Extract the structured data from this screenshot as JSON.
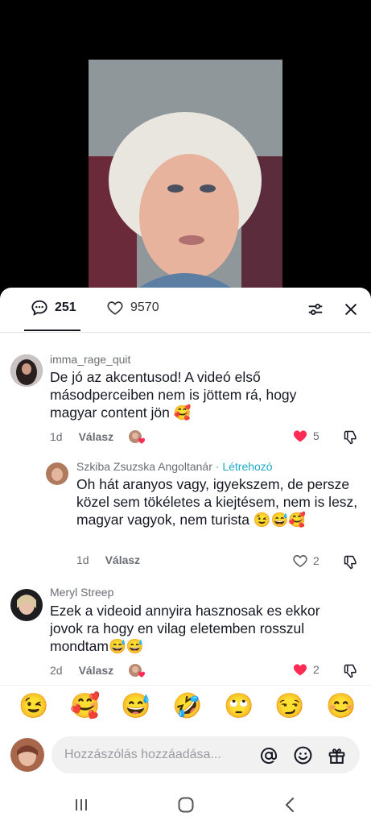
{
  "tabs": {
    "comments_count": "251",
    "likes_count": "9570"
  },
  "comments": [
    {
      "username": "imma_rage_quit",
      "text": "De jó az akcentusod! A videó első másodperceiben nem is jöttem rá, hogy magyar content jön 🥰",
      "age": "1d",
      "reply_label": "Válasz",
      "likes": "5",
      "liked": true
    },
    {
      "username": "Szkiba Zsuzska Angoltanár",
      "creator_label": "· Létrehozó",
      "text": "Oh hát aranyos vagy, igyekszem, de persze közel sem tökéletes a kiejtésem, nem is lesz, magyar vagyok, nem turista 😉😅🥰",
      "age": "1d",
      "reply_label": "Válasz",
      "likes": "2",
      "liked": false
    },
    {
      "username": "Meryl  Streep",
      "text": "Ezek a videoid annyira hasznosak es ekkor jovok ra hogy en vilag eletemben rosszul mondtam😅😅",
      "age": "2d",
      "reply_label": "Válasz",
      "likes": "2",
      "liked": true
    }
  ],
  "emoji_bar": [
    "😉",
    "🥰",
    "😅",
    "🤣",
    "🙄",
    "😏",
    "😊"
  ],
  "composer": {
    "placeholder": "Hozzászólás hozzáadása..."
  },
  "colors": {
    "like_red": "#fe2c55",
    "creator_teal": "#20a9c7"
  }
}
